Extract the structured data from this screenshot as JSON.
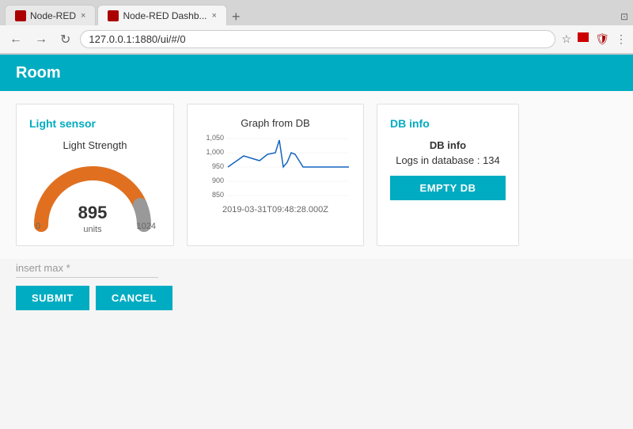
{
  "browser": {
    "tabs": [
      {
        "id": "tab1",
        "label": "Node-RED",
        "active": false,
        "icon": "red"
      },
      {
        "id": "tab2",
        "label": "Node-RED Dashb...",
        "active": true,
        "icon": "red"
      }
    ],
    "address": "127.0.0.1:1880/ui/#/0"
  },
  "header": {
    "title": "Room"
  },
  "light_sensor": {
    "title": "Light sensor",
    "gauge_label": "Light Strength",
    "value": 895,
    "min": 0,
    "max": 1024,
    "unit": "units"
  },
  "graph": {
    "title": "Graph from DB",
    "y_labels": [
      "1,050",
      "1,000",
      "950",
      "900",
      "850"
    ],
    "timestamp": "2019-03-31T09:48:28.000Z"
  },
  "db_info": {
    "title": "DB info",
    "info_label": "DB info",
    "logs_label": "Logs in database : 134",
    "empty_db_button": "EMPTY DB"
  },
  "form": {
    "input_placeholder": "insert max *",
    "submit_button": "SUBMIT",
    "cancel_button": "CANCEL"
  },
  "colors": {
    "accent": "#00ACC1",
    "gauge_fill": "#E07020",
    "gauge_empty": "#999"
  }
}
